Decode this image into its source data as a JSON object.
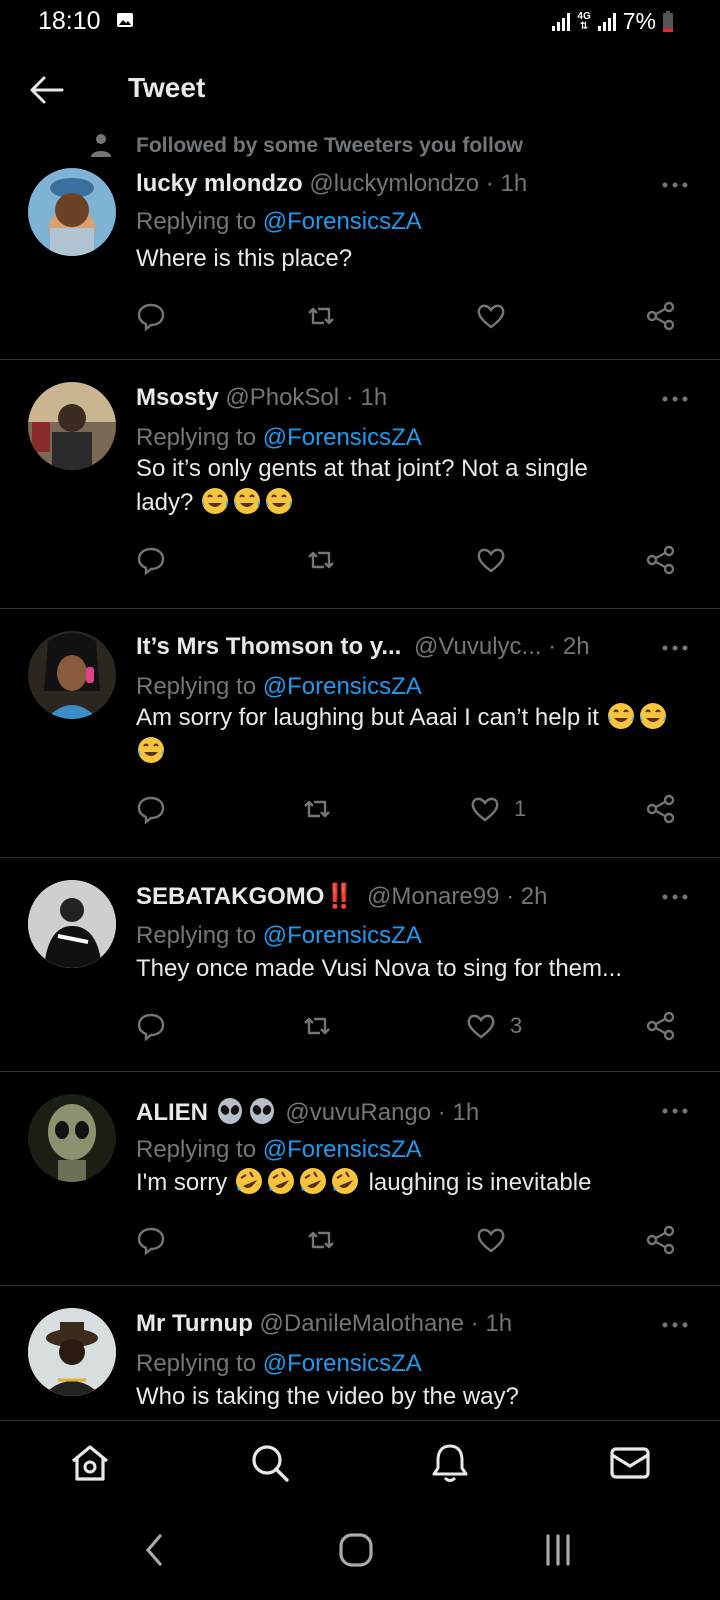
{
  "status_bar": {
    "time": "18:10",
    "network": "4G",
    "battery": "7%"
  },
  "header": {
    "title": "Tweet"
  },
  "social_context": {
    "text": "Followed by some Tweeters you follow"
  },
  "replying_label": "Replying to",
  "reply_to_handle": "@ForensicsZA",
  "tweets": [
    {
      "name": "lucky mlondzo",
      "handle": "@luckymlondzo",
      "time": "1h",
      "text": "Where is this place?",
      "likes": ""
    },
    {
      "name": "Msosty",
      "handle": "@PhokSol",
      "time": "1h",
      "text_line1": "So it’s only gents at that joint? Not a single",
      "text_line2": "lady?",
      "likes": ""
    },
    {
      "name": "It’s Mrs Thomson to y...",
      "handle": "@Vuvulyc...",
      "time": "2h",
      "text": "Am sorry for laughing but Aaai I can’t help it",
      "likes": "1"
    },
    {
      "name": "SEBATAKGOMO",
      "badge": "‼️",
      "handle": "@Monare99",
      "time": "2h",
      "text": "They once made Vusi Nova to sing for them...",
      "likes": "3"
    },
    {
      "name": "ALIEN",
      "handle": "@vuvuRango",
      "time": "1h",
      "text_before": "I'm sorry",
      "text_after": "laughing is inevitable",
      "likes": ""
    },
    {
      "name": "Mr Turnup",
      "handle": "@DanileMalothane",
      "time": "1h",
      "text": "Who is taking the video by the way?"
    }
  ],
  "icons": {
    "back": "arrow-left-icon",
    "more": "more-dots-icon",
    "reply": "reply-icon",
    "retweet": "retweet-icon",
    "like": "heart-icon",
    "share": "share-icon",
    "home": "home-icon",
    "search": "search-icon",
    "notifications": "bell-icon",
    "messages": "mail-icon"
  },
  "colors": {
    "background": "#000000",
    "text": "#e7e9ea",
    "muted": "#71767b",
    "link": "#1d9bf0",
    "divider": "#2f3336",
    "battery_low": "#f4212e"
  }
}
